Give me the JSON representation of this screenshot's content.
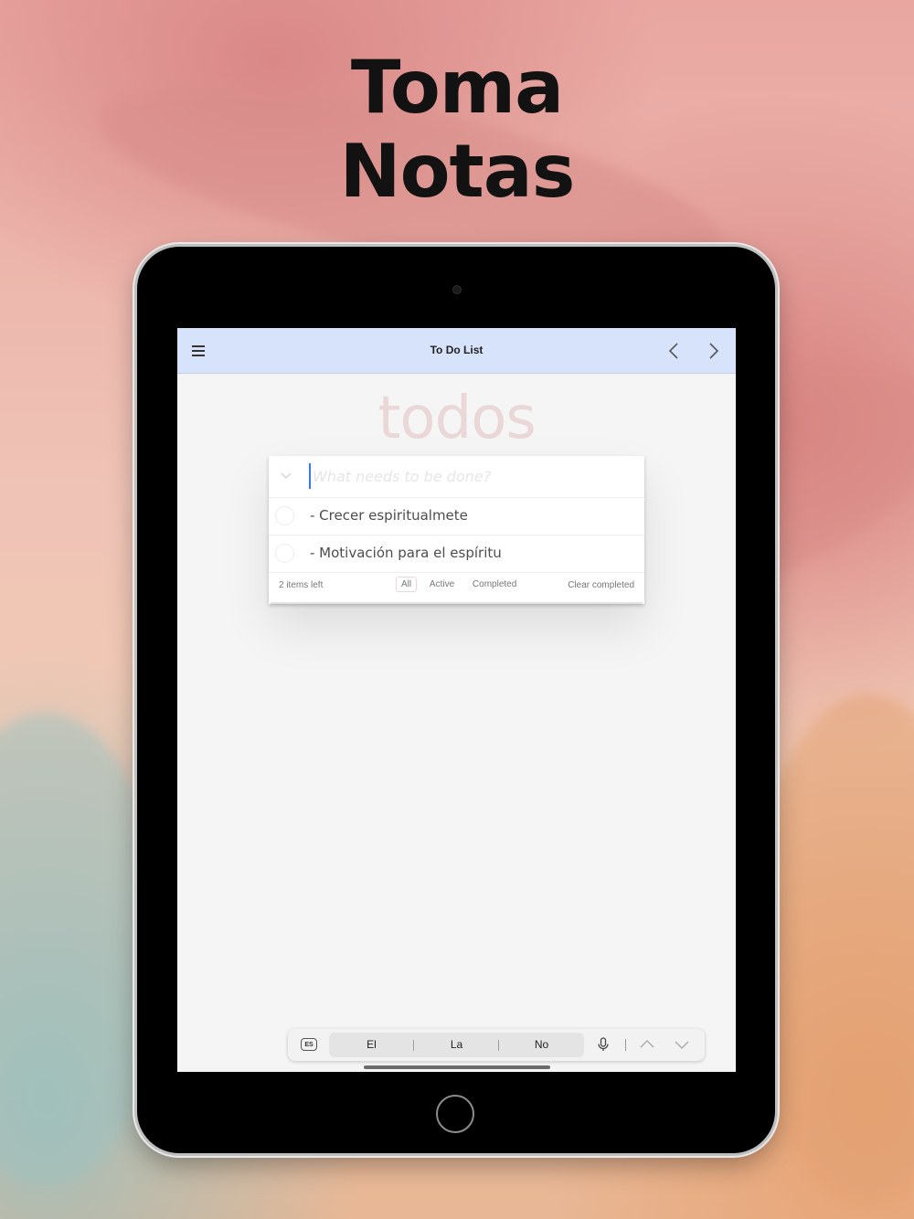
{
  "headline": {
    "line1": "Toma",
    "line2": "Notas"
  },
  "navbar": {
    "title": "To Do List",
    "menu_icon": "hamburger-icon",
    "back_icon": "chevron-left-icon",
    "forward_icon": "chevron-right-icon"
  },
  "app": {
    "heading": "todos",
    "new_todo_placeholder": "What needs to be done?",
    "items": [
      {
        "label": "- Crecer espiritualmete",
        "completed": false
      },
      {
        "label": "- Motivación para el espíritu",
        "completed": false
      }
    ],
    "footer": {
      "count": "2 items left",
      "filters": [
        "All",
        "Active",
        "Completed"
      ],
      "selected_filter": "All",
      "clear": "Clear completed"
    }
  },
  "keyboard_bar": {
    "language_key": "ES",
    "suggestions": [
      "El",
      "La",
      "No"
    ],
    "mic_icon": "microphone-icon",
    "up_icon": "chevron-up-icon",
    "down_icon": "chevron-down-icon"
  }
}
